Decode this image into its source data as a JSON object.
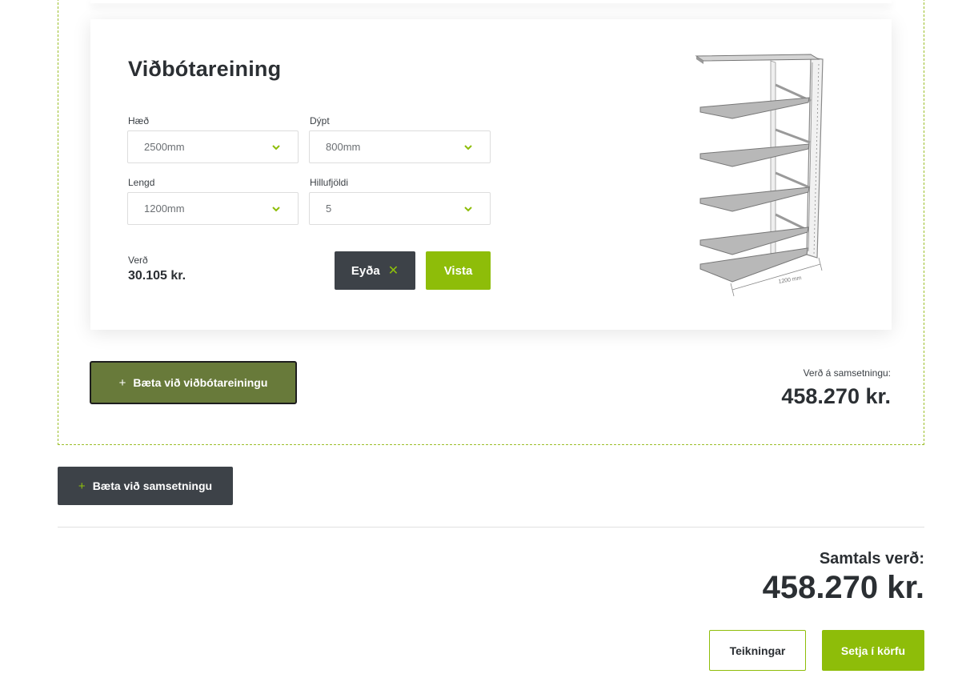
{
  "unit": {
    "title": "Viðbótareining",
    "fields": [
      {
        "label": "Hæð",
        "value": "2500mm"
      },
      {
        "label": "Dýpt",
        "value": "800mm"
      },
      {
        "label": "Lengd",
        "value": "1200mm"
      },
      {
        "label": "Hillufjöldi",
        "value": "5"
      }
    ],
    "price_label": "Verð",
    "price_value": "30.105 kr.",
    "delete_label": "Eyða",
    "delete_icon": "close-icon",
    "save_label": "Vista",
    "image": {
      "dimension_label": "1200 mm",
      "shelf_count": 5
    }
  },
  "add_unit_label": "Bæta við viðbótareiningu",
  "config_price_label": "Verð á samsetningu:",
  "config_price_value": "458.270 kr.",
  "add_config_label": "Bæta við samsetningu",
  "total_label": "Samtals verð:",
  "total_value": "458.270 kr.",
  "drawings_label": "Teikningar",
  "cart_label": "Setja í körfu",
  "colors": {
    "accent_green": "#8ebd09",
    "olive": "#687a3a",
    "dark": "#3d4248"
  }
}
